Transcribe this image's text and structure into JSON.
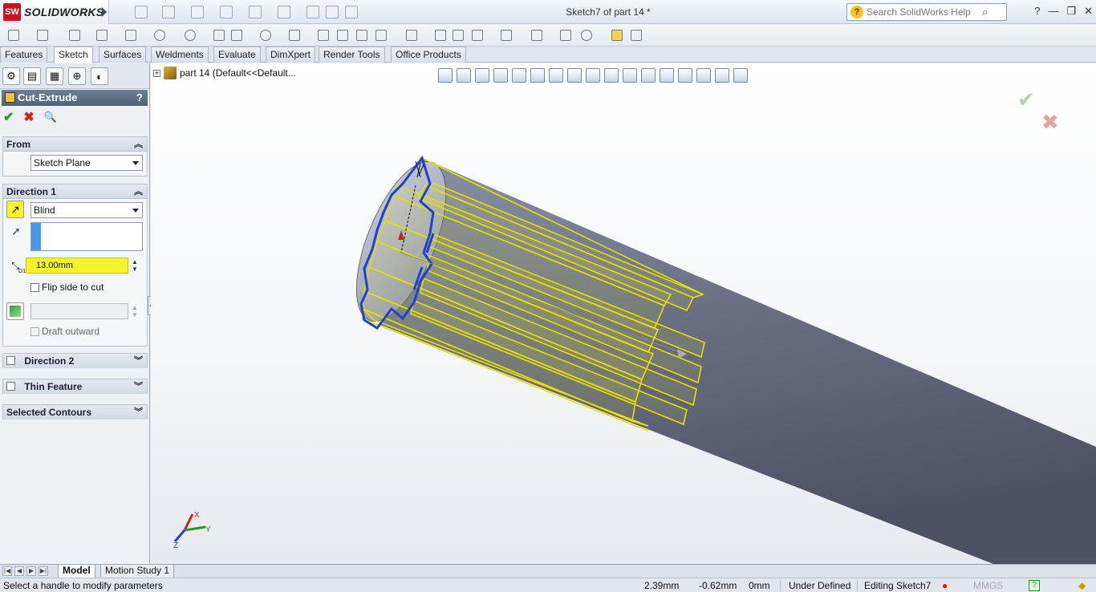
{
  "app": {
    "brand_mark": "SW",
    "brand": "SOLIDWORKS",
    "window_title": "Sketch7 of part 14 *",
    "search_placeholder": "Search SolidWorks Help"
  },
  "command_tabs": [
    "Features",
    "Sketch",
    "Surfaces",
    "Weldments",
    "Evaluate",
    "DimXpert",
    "Render Tools",
    "Office Products"
  ],
  "active_tab": "Sketch",
  "property_manager": {
    "title": "Cut-Extrude",
    "help": "?",
    "from": {
      "label": "From",
      "value": "Sketch Plane"
    },
    "direction1": {
      "label": "Direction 1",
      "end_condition": "Blind",
      "depth": "13.00mm",
      "depth_symbol": "D1",
      "flip_side_label": "Flip side to cut",
      "draft_outward_label": "Draft outward"
    },
    "direction2": {
      "label": "Direction 2"
    },
    "thin_feature": {
      "label": "Thin Feature"
    },
    "selected_contours": {
      "label": "Selected Contours"
    }
  },
  "feature_tree": {
    "root_label": "part 14  (Default<<Default..."
  },
  "bottom_tabs": [
    "Model",
    "Motion Study 1"
  ],
  "status_bar": {
    "message": "Select a handle to modify parameters",
    "x": "2.39mm",
    "y": "-0.62mm",
    "z": "0mm",
    "state": "Under Defined",
    "editing": "Editing Sketch7",
    "units": "MMGS"
  },
  "colors": {
    "highlight": "#f5f32b",
    "sketch_blue": "#1f3fd6",
    "cylinder": "#6b7183",
    "pm_header": "#4f6278"
  }
}
